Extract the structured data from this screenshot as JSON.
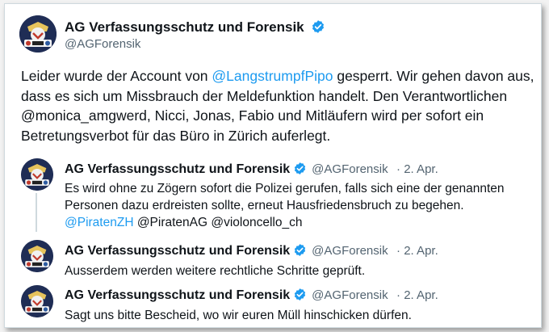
{
  "main_tweet": {
    "display_name": "AG Verfassungsschutz und Forensik",
    "handle": "@AGForensik",
    "text_before": "Leider wurde der Account von ",
    "mention": "@LangstrumpfPipo",
    "text_after": " gesperrt. Wir gehen davon aus, dass es sich um Missbrauch der Meldefunktion handelt. Den Verantwortlichen @monica_amgwerd, Nicci, Jonas, Fabio und Mitläufern wird per sofort ein Betretungsverbot für das Büro in Zürich auferlegt."
  },
  "replies": [
    {
      "display_name": "AG Verfassungsschutz und Forensik",
      "handle": "@AGForensik",
      "date": "· 2. Apr.",
      "text_before": "Es wird ohne zu Zögern sofort die Polizei gerufen, falls sich eine der genannten Personen dazu erdreisten sollte, erneut Hausfriedensbruch zu begehen. ",
      "mention": "@PiratenZH",
      "text_after": " @PiratenAG @violoncello_ch"
    },
    {
      "display_name": "AG Verfassungsschutz und Forensik",
      "handle": "@AGForensik",
      "date": "· 2. Apr.",
      "text": "Ausserdem werden weitere rechtliche Schritte geprüft."
    },
    {
      "display_name": "AG Verfassungsschutz und Forensik",
      "handle": "@AGForensik",
      "date": "· 2. Apr.",
      "text": "Sagt uns bitte Bescheid, wo wir euren Müll hinschicken dürfen."
    }
  ],
  "icons": {
    "verified": "verified-badge-icon",
    "avatar": "profile-avatar-emblem"
  },
  "colors": {
    "link": "#1d9bf0",
    "verified": "#1d9bf0",
    "secondary_text": "#536471",
    "primary_text": "#0f1419"
  }
}
